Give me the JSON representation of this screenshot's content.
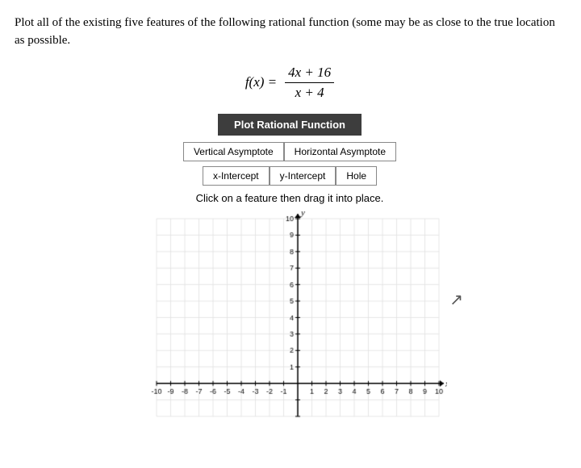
{
  "instruction": "Plot all of the existing five features of the following rational function (some may be as close to the true location as possible.",
  "function_label": "f(x) =",
  "numerator": "4x + 16",
  "denominator": "x + 4",
  "plot_button": "Plot Rational Function",
  "feature_buttons_row1": [
    "Vertical Asymptote",
    "Horizontal Asymptote"
  ],
  "feature_buttons_row2": [
    "x-Intercept",
    "y-Intercept",
    "Hole"
  ],
  "drag_instruction": "Click on a feature then drag it into place.",
  "graph": {
    "x_label": "x",
    "y_label": "y",
    "x_min": -10,
    "x_max": 10,
    "y_min": -2,
    "y_max": 10,
    "grid_color": "#e0e0e0",
    "axis_color": "#000"
  }
}
